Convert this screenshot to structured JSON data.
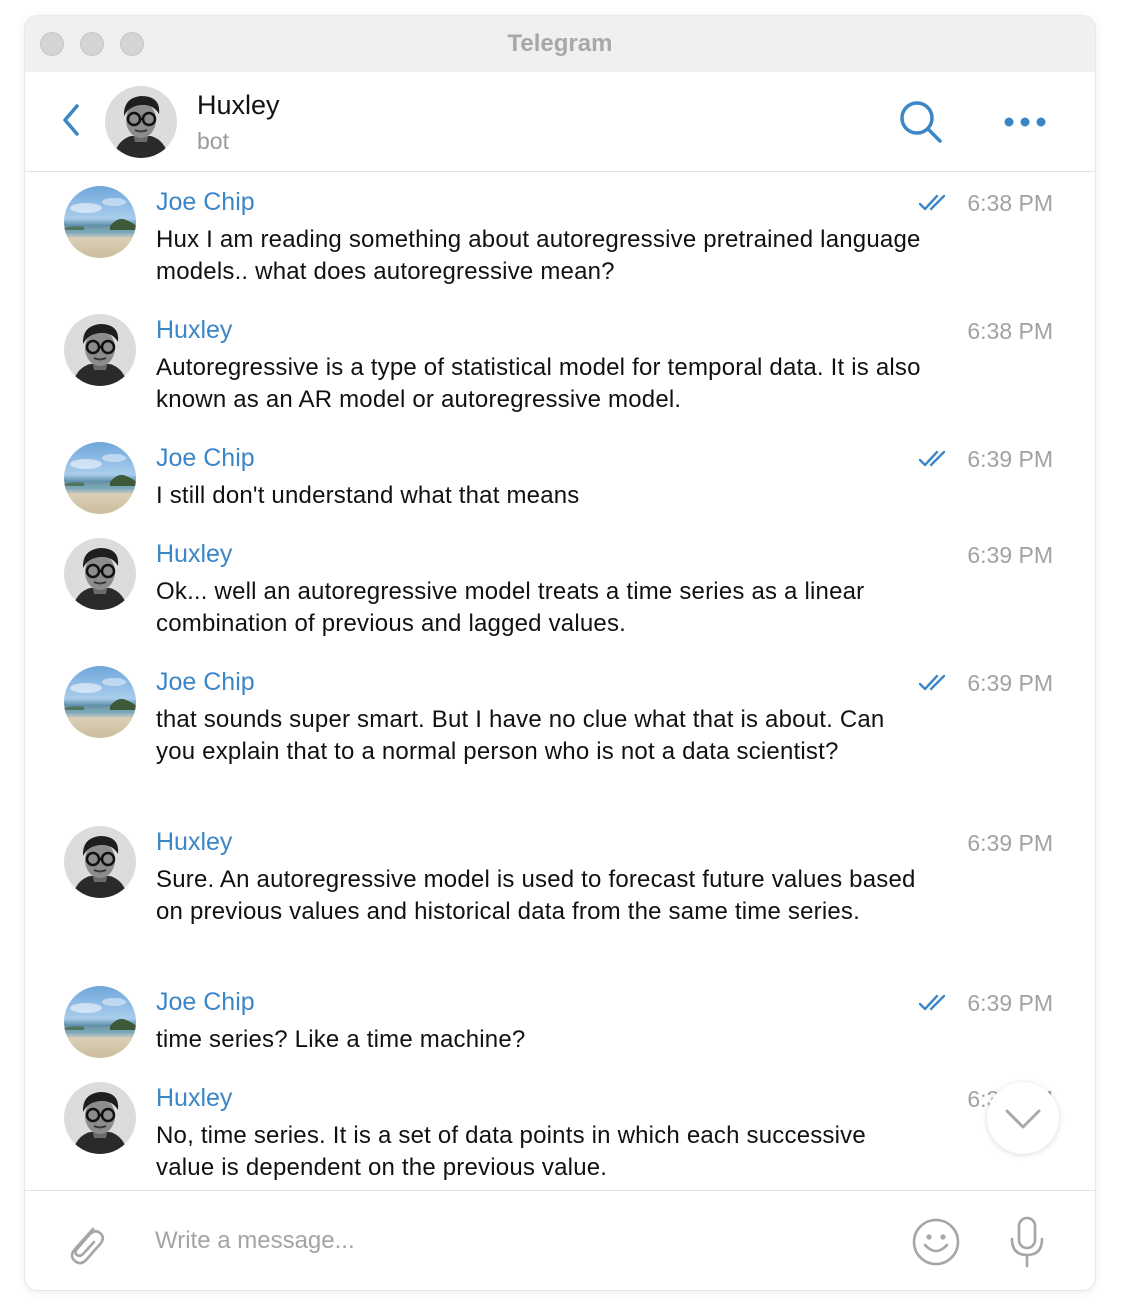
{
  "window": {
    "title": "Telegram"
  },
  "chat": {
    "name": "Huxley",
    "status": "bot"
  },
  "colors": {
    "accent": "#3b86c6",
    "time": "#a2a2a2",
    "text": "#111111"
  },
  "icons": {
    "back": "chevron-left-icon",
    "search": "search-icon",
    "more": "more-dots-icon",
    "attach": "paperclip-icon",
    "emoji": "smiley-icon",
    "mic": "microphone-icon",
    "scroll": "chevron-down-icon",
    "read": "double-check-icon"
  },
  "messages": [
    {
      "sender": "Joe Chip",
      "avatar": "beach",
      "time": "6:38 PM",
      "read": true,
      "text": "Hux I am reading something about autoregressive pretrained language models.. what does autoregressive mean?"
    },
    {
      "sender": "Huxley",
      "avatar": "portrait",
      "time": "6:38 PM",
      "read": false,
      "text": "Autoregressive is a type of statistical model for temporal data. It is also known as an AR model or autoregressive model."
    },
    {
      "sender": "Joe Chip",
      "avatar": "beach",
      "time": "6:39 PM",
      "read": true,
      "text": "I still don't understand what that means"
    },
    {
      "sender": "Huxley",
      "avatar": "portrait",
      "time": "6:39 PM",
      "read": false,
      "text": "Ok... well an autoregressive model treats a time series as a linear combination of previous and lagged values."
    },
    {
      "sender": "Joe Chip",
      "avatar": "beach",
      "time": "6:39 PM",
      "read": true,
      "text": "that sounds super smart. But I have no clue what that is about. Can you explain that to a normal person who is not a data scientist?"
    },
    {
      "sender": "Huxley",
      "avatar": "portrait",
      "time": "6:39 PM",
      "read": false,
      "text": "Sure. An autoregressive model is used to forecast future values based on previous values and historical data from the same time series."
    },
    {
      "sender": "Joe Chip",
      "avatar": "beach",
      "time": "6:39 PM",
      "read": true,
      "text": "time series? Like a time machine?"
    },
    {
      "sender": "Huxley",
      "avatar": "portrait",
      "time": "6:39 PM",
      "read": false,
      "text": "No, time series. It is a set of data points in which each successive value is dependent on the previous value."
    }
  ],
  "composer": {
    "placeholder": "Write a message..."
  }
}
